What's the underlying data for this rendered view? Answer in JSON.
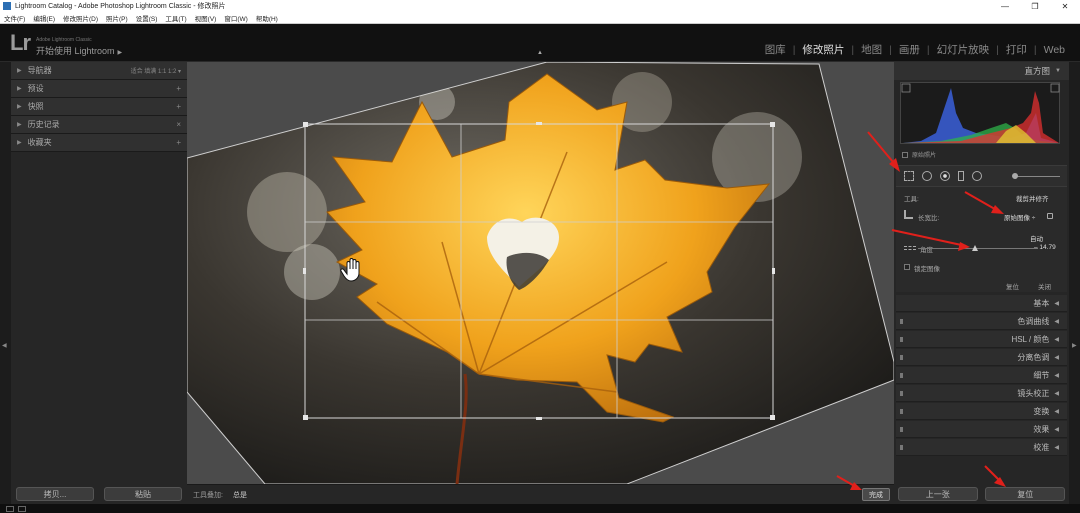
{
  "window": {
    "title": "Lightroom Catalog - Adobe Photoshop Lightroom Classic - 修改照片",
    "minimize": "—",
    "maximize": "❐",
    "close": "✕"
  },
  "menu": [
    "文件(F)",
    "编辑(E)",
    "修改照片(D)",
    "照片(P)",
    "设置(S)",
    "工具(T)",
    "视图(V)",
    "窗口(W)",
    "帮助(H)"
  ],
  "identity": {
    "logo": "Lr",
    "small": "Adobe Lightroom Classic",
    "line": "开始使用 Lightroom",
    "arrow": "▶"
  },
  "modules": [
    {
      "label": "图库",
      "active": false
    },
    {
      "label": "修改照片",
      "active": true
    },
    {
      "label": "地图",
      "active": false
    },
    {
      "label": "画册",
      "active": false
    },
    {
      "label": "幻灯片放映",
      "active": false
    },
    {
      "label": "打印",
      "active": false
    },
    {
      "label": "Web",
      "active": false
    }
  ],
  "left_panel": {
    "navigator": {
      "label": "导航器",
      "options": "适合  填满  1:1  1:2 ▾"
    },
    "sections": [
      {
        "label": "预设",
        "icon": "+"
      },
      {
        "label": "快照",
        "icon": "+"
      },
      {
        "label": "历史记录",
        "icon": "×"
      },
      {
        "label": "收藏夹",
        "icon": "+"
      }
    ],
    "copy_button": "拷贝...",
    "paste_button": "粘贴"
  },
  "toolbar": {
    "overlay_label": "工具叠加:",
    "overlay_value": "总是",
    "done_button": "完成"
  },
  "right_panel": {
    "histogram_label": "直方图",
    "original_photo_label": "原始照片",
    "crop": {
      "tool_label": "工具:",
      "tool_value": "裁剪并修齐",
      "aspect_label": "长宽比:",
      "aspect_value": "原始图像 ÷",
      "auto_label": "自动",
      "angle_label": "角度",
      "angle_value": "– 14.79",
      "constrain_label": "锁定图像",
      "reset_label": "复位",
      "close_label": "关闭"
    },
    "sections": [
      "基本",
      "色调曲线",
      "HSL / 颜色",
      "分离色调",
      "细节",
      "镜头校正",
      "变换",
      "效果",
      "校准"
    ],
    "previous_button": "上一张",
    "reset_button": "复位"
  },
  "colors": {
    "accent_arrow": "#e0201b",
    "leaf_orange": "#f0a21c",
    "panel_bg": "#262626"
  }
}
